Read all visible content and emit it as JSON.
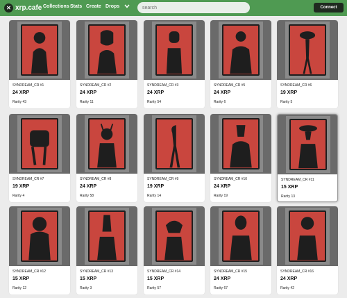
{
  "header": {
    "logo_mark": "✕",
    "logo_text": "xrp.cafe",
    "nav": [
      "Collections",
      "Stats",
      "Create",
      "Drops"
    ],
    "nav_more_icon": "chevron-down-icon",
    "search_placeholder": "search",
    "connect_label": "Connect",
    "bar_color": "#4f9a52"
  },
  "cards": [
    {
      "name": "SYNDREAM_CR #1",
      "price": "24 XRP",
      "rarity": "Rarity 43"
    },
    {
      "name": "SYNDREAM_CR #2",
      "price": "24 XRP",
      "rarity": "Rarity 11"
    },
    {
      "name": "SYNDREAM_CR #3",
      "price": "24 XRP",
      "rarity": "Rarity 54"
    },
    {
      "name": "SYNDREAM_CR #5",
      "price": "24 XRP",
      "rarity": "Rarity 6"
    },
    {
      "name": "SYNDREAM_CR #6",
      "price": "19 XRP",
      "rarity": "Rarity 5"
    },
    {
      "name": "SYNDREAM_CR #7",
      "price": "19 XRP",
      "rarity": "Rarity 4"
    },
    {
      "name": "SYNDREAM_CR #8",
      "price": "24 XRP",
      "rarity": "Rarity 58"
    },
    {
      "name": "SYNDREAM_CR #9",
      "price": "19 XRP",
      "rarity": "Rarity 14"
    },
    {
      "name": "SYNDREAM_CR #10",
      "price": "24 XRP",
      "rarity": "Rarity 19"
    },
    {
      "name": "SYNDREAM_CR #11",
      "price": "15 XRP",
      "rarity": "Rarity 13",
      "highlighted": true
    },
    {
      "name": "SYNDREAM_CR #12",
      "price": "15 XRP",
      "rarity": "Rarity 12"
    },
    {
      "name": "SYNDREAM_CR #13",
      "price": "15 XRP",
      "rarity": "Rarity 3"
    },
    {
      "name": "SYNDREAM_CR #14",
      "price": "15 XRP",
      "rarity": "Rarity 57"
    },
    {
      "name": "SYNDREAM_CR #15",
      "price": "24 XRP",
      "rarity": "Rarity 67"
    },
    {
      "name": "SYNDREAM_CR #16",
      "price": "24 XRP",
      "rarity": "Rarity 42"
    }
  ]
}
